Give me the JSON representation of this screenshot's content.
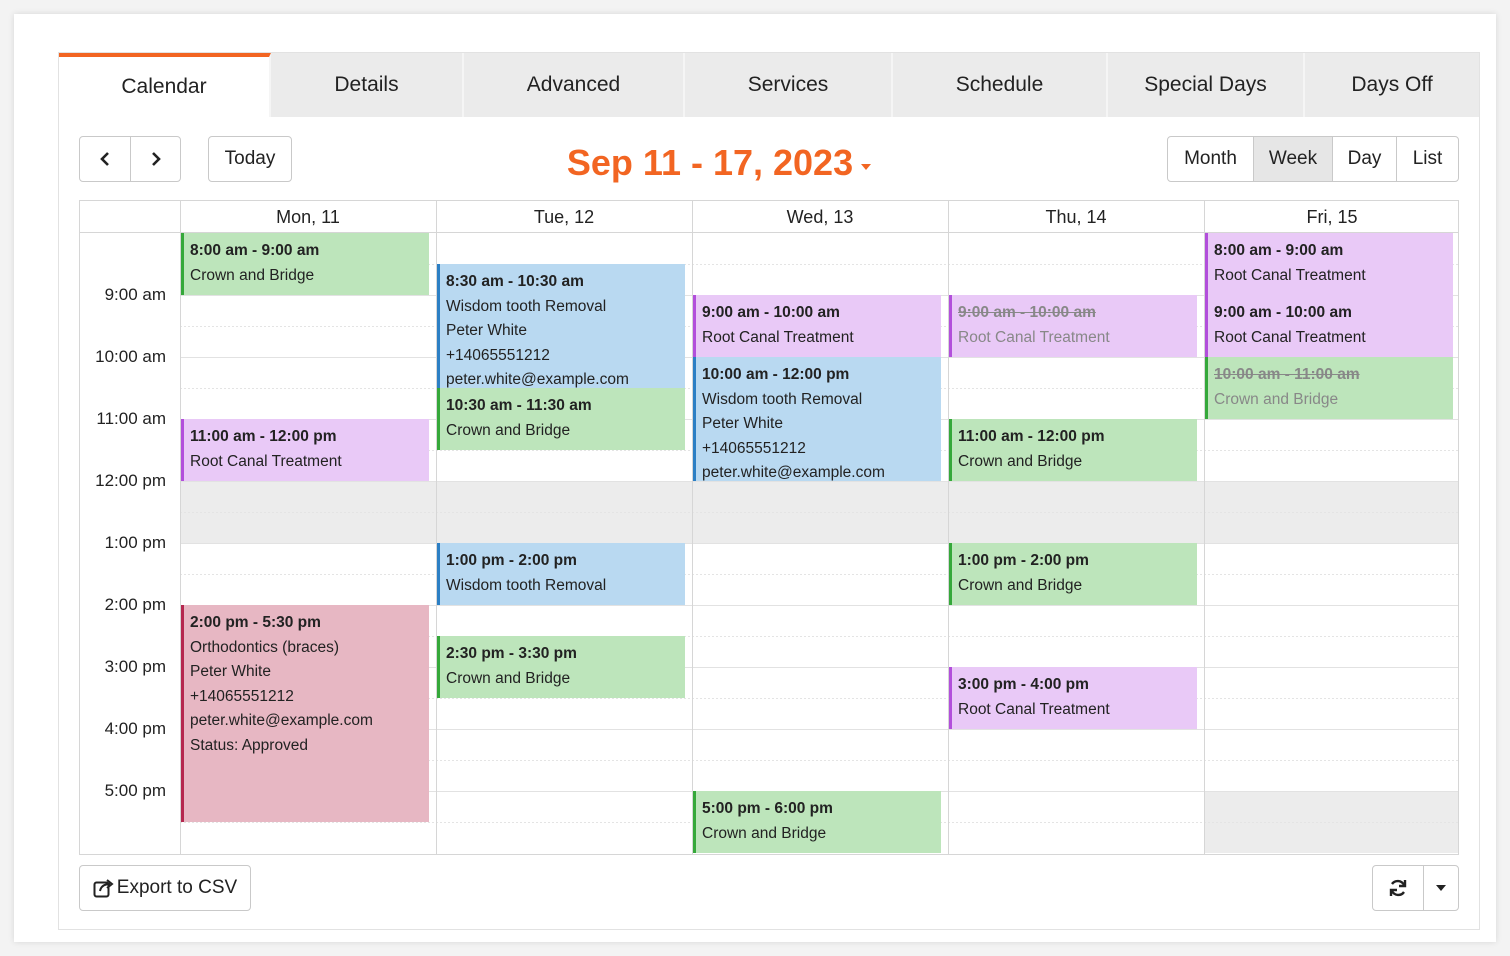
{
  "tabs": [
    "Calendar",
    "Details",
    "Advanced",
    "Services",
    "Schedule",
    "Special Days",
    "Days Off"
  ],
  "toolbar": {
    "prev": "‹",
    "next": "›",
    "today": "Today",
    "range": "Sep 11 - 17, 2023",
    "views": [
      "Month",
      "Week",
      "Day",
      "List"
    ],
    "active_view": "Week"
  },
  "days": [
    "Mon, 11",
    "Tue, 12",
    "Wed, 13",
    "Thu, 14",
    "Fri, 15"
  ],
  "time_labels": [
    "9:00 am",
    "10:00 am",
    "11:00 am",
    "12:00 pm",
    "1:00 pm",
    "2:00 pm",
    "3:00 pm",
    "4:00 pm",
    "5:00 pm"
  ],
  "events": [
    {
      "day": 0,
      "start": 8.0,
      "end": 9.0,
      "color": "green",
      "cancelled": false,
      "lines": [
        "8:00 am - 9:00 am",
        "Crown and Bridge"
      ]
    },
    {
      "day": 0,
      "start": 11.0,
      "end": 12.0,
      "color": "purple",
      "cancelled": false,
      "lines": [
        "11:00 am - 12:00 pm",
        "Root Canal Treatment"
      ]
    },
    {
      "day": 0,
      "start": 14.0,
      "end": 17.5,
      "color": "pink",
      "cancelled": false,
      "lines": [
        "2:00 pm - 5:30 pm",
        "Orthodontics (braces)",
        "Peter White",
        "+14065551212",
        "peter.white@example.com",
        "Status: Approved"
      ]
    },
    {
      "day": 1,
      "start": 8.5,
      "end": 10.5,
      "color": "blue",
      "cancelled": false,
      "lines": [
        "8:30 am - 10:30 am",
        "Wisdom tooth Removal",
        "Peter White",
        "+14065551212",
        "peter.white@example.com"
      ]
    },
    {
      "day": 1,
      "start": 10.5,
      "end": 11.5,
      "color": "green",
      "cancelled": false,
      "lines": [
        "10:30 am - 11:30 am",
        "Crown and Bridge"
      ]
    },
    {
      "day": 1,
      "start": 13.0,
      "end": 14.0,
      "color": "blue",
      "cancelled": false,
      "lines": [
        "1:00 pm - 2:00 pm",
        "Wisdom tooth Removal"
      ]
    },
    {
      "day": 1,
      "start": 14.5,
      "end": 15.5,
      "color": "green",
      "cancelled": false,
      "lines": [
        "2:30 pm - 3:30 pm",
        "Crown and Bridge"
      ]
    },
    {
      "day": 2,
      "start": 9.0,
      "end": 10.0,
      "color": "purple",
      "cancelled": false,
      "lines": [
        "9:00 am - 10:00 am",
        "Root Canal Treatment"
      ]
    },
    {
      "day": 2,
      "start": 10.0,
      "end": 12.0,
      "color": "blue",
      "cancelled": false,
      "lines": [
        "10:00 am - 12:00 pm",
        "Wisdom tooth Removal",
        "Peter White",
        "+14065551212",
        "peter.white@example.com"
      ]
    },
    {
      "day": 2,
      "start": 17.0,
      "end": 18.0,
      "color": "green",
      "cancelled": false,
      "lines": [
        "5:00 pm - 6:00 pm",
        "Crown and Bridge"
      ]
    },
    {
      "day": 3,
      "start": 9.0,
      "end": 10.0,
      "color": "purple",
      "cancelled": true,
      "lines": [
        "9:00 am - 10:00 am",
        "Root Canal Treatment"
      ]
    },
    {
      "day": 3,
      "start": 11.0,
      "end": 12.0,
      "color": "green",
      "cancelled": false,
      "lines": [
        "11:00 am - 12:00 pm",
        "Crown and Bridge"
      ]
    },
    {
      "day": 3,
      "start": 13.0,
      "end": 14.0,
      "color": "green",
      "cancelled": false,
      "lines": [
        "1:00 pm - 2:00 pm",
        "Crown and Bridge"
      ]
    },
    {
      "day": 3,
      "start": 15.0,
      "end": 16.0,
      "color": "purple",
      "cancelled": false,
      "lines": [
        "3:00 pm - 4:00 pm",
        "Root Canal Treatment"
      ]
    },
    {
      "day": 4,
      "start": 8.0,
      "end": 9.0,
      "color": "purple",
      "cancelled": false,
      "lines": [
        "8:00 am - 9:00 am",
        "Root Canal Treatment"
      ]
    },
    {
      "day": 4,
      "start": 9.0,
      "end": 10.0,
      "color": "purple",
      "cancelled": false,
      "lines": [
        "9:00 am - 10:00 am",
        "Root Canal Treatment"
      ]
    },
    {
      "day": 4,
      "start": 10.0,
      "end": 11.0,
      "color": "green",
      "cancelled": true,
      "lines": [
        "10:00 am - 11:00 am",
        "Crown and Bridge"
      ]
    }
  ],
  "footer": {
    "export": "Export to CSV"
  },
  "icons": {
    "export": "export-icon",
    "refresh": "refresh-icon",
    "dropdown": "caret-down-icon"
  },
  "colors": {
    "accent": "#f26522",
    "green": "#bde5bb",
    "blue": "#b9d9f1",
    "purple": "#e9c9f7",
    "pink": "#e7b7c3"
  }
}
